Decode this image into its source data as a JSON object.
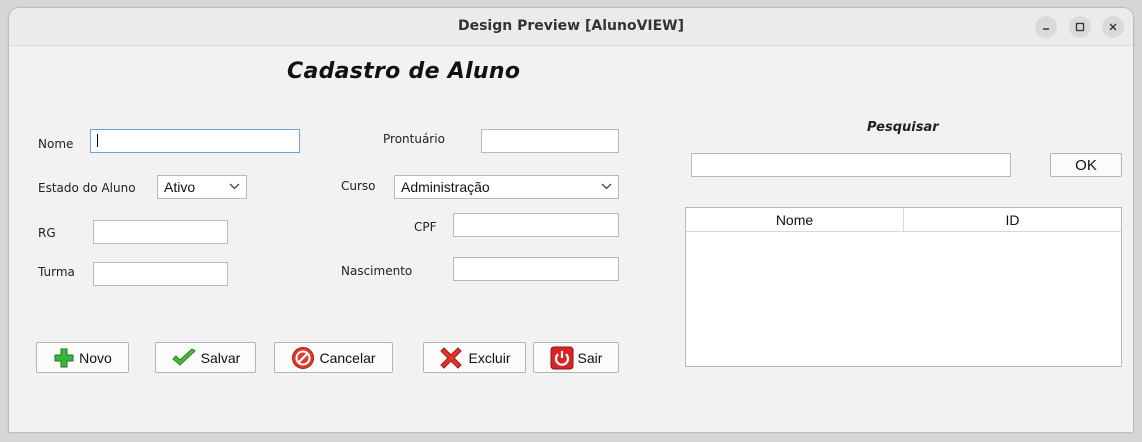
{
  "window": {
    "title": "Design Preview [AlunoVIEW]"
  },
  "form": {
    "heading": "Cadastro de Aluno",
    "nome_label": "Nome",
    "prontuario_label": "Prontuário",
    "estado_label": "Estado do Aluno",
    "estado_value": "Ativo",
    "curso_label": "Curso",
    "curso_value": "Administração",
    "rg_label": "RG",
    "cpf_label": "CPF",
    "turma_label": "Turma",
    "nascimento_label": "Nascimento"
  },
  "buttons": {
    "novo": "Novo",
    "salvar": "Salvar",
    "cancelar": "Cancelar",
    "excluir": "Excluir",
    "sair": "Sair"
  },
  "search": {
    "label": "Pesquisar",
    "ok": "OK",
    "columns": [
      "Nome",
      "ID"
    ]
  }
}
